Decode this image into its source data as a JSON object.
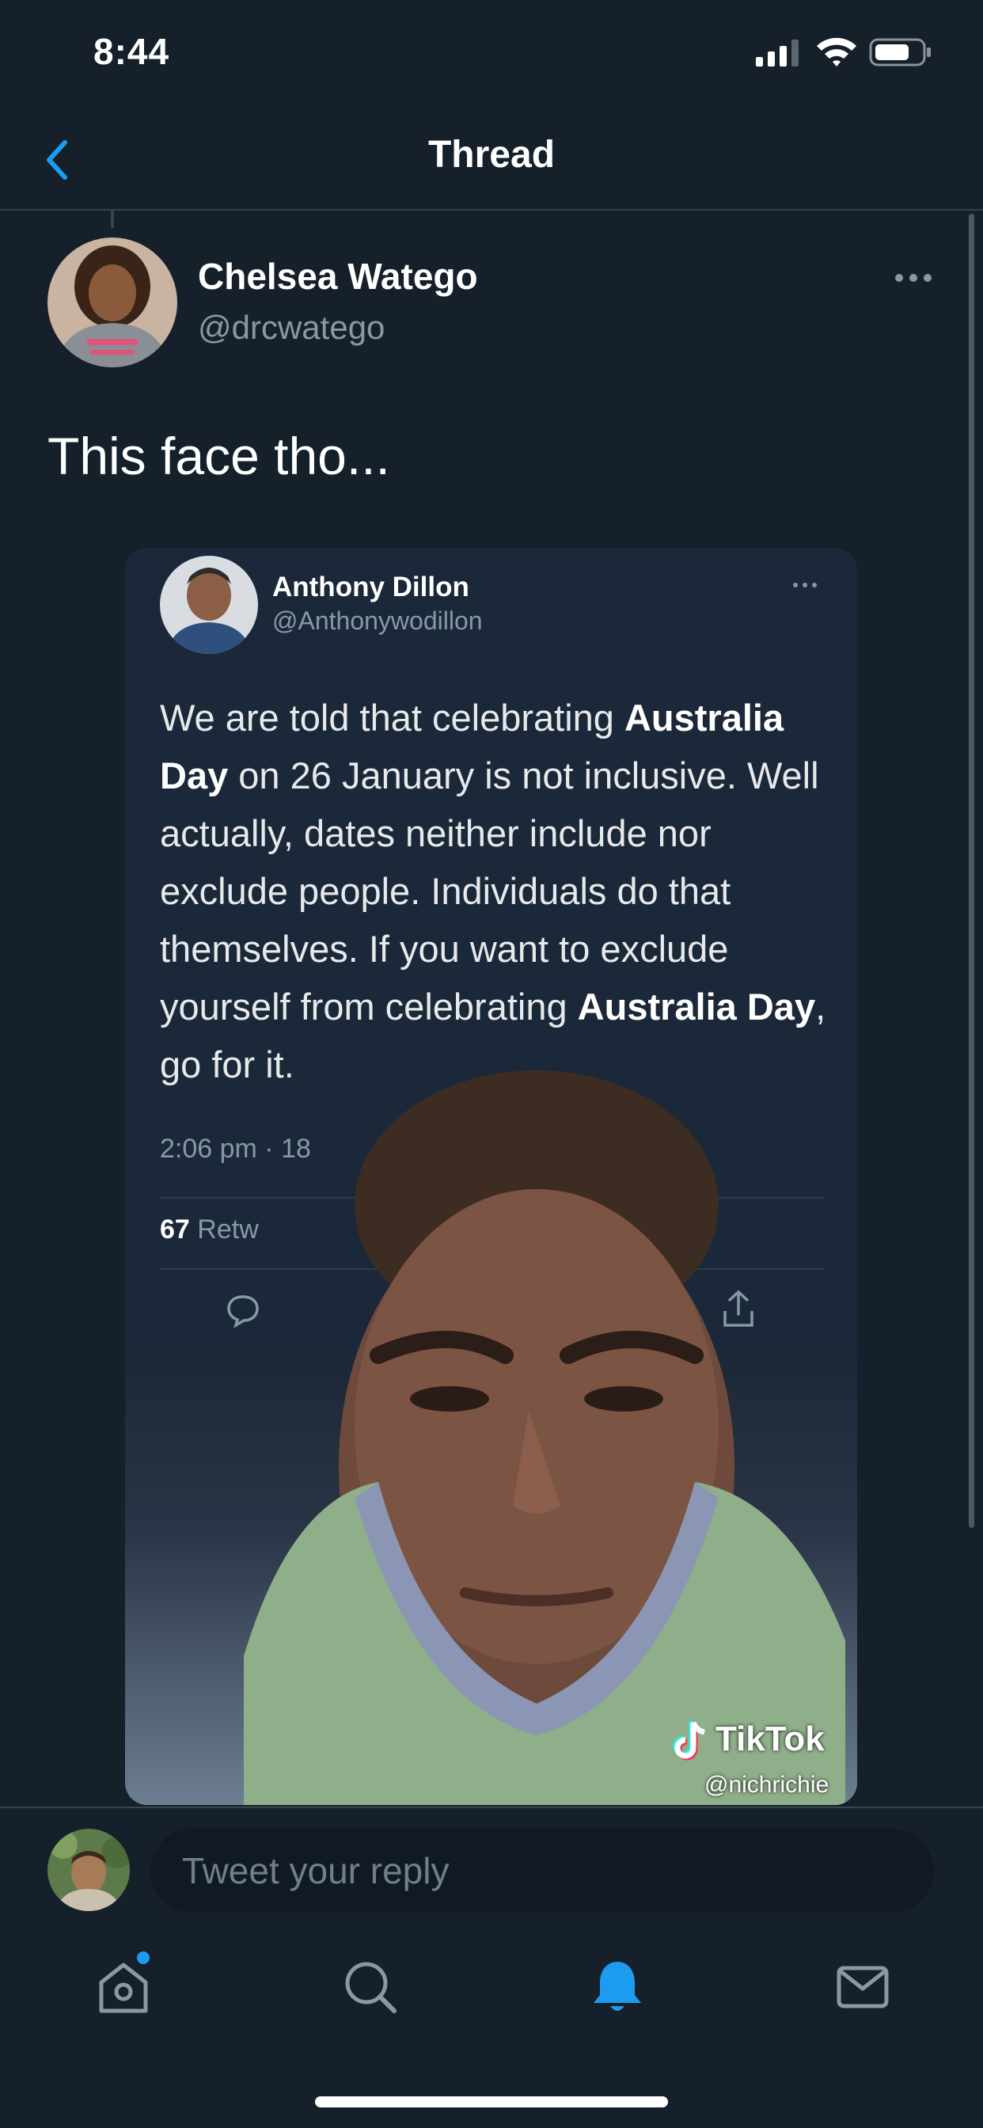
{
  "status_bar": {
    "time": "8:44"
  },
  "header": {
    "title": "Thread"
  },
  "tweet": {
    "author_name": "Chelsea Watego",
    "author_handle": "@drcwatego",
    "text": "This face tho..."
  },
  "embedded_tweet": {
    "author_name": "Anthony Dillon",
    "author_handle": "@Anthonywodillon",
    "text_parts": {
      "p1": "We are told that celebrating ",
      "b1": "Australia Day",
      "p2": " on 26 January is not inclusive. Well actually, dates neither include nor exclude people. Individuals do that themselves. If you want to exclude yourself from celebrating ",
      "b2": "Australia Day",
      "p3": ", go for it."
    },
    "time": "2:06 pm · 18",
    "retweets_count": "67",
    "retweets_label": "Retw"
  },
  "video": {
    "platform": "TikTok",
    "handle": "@nichrichie"
  },
  "reply": {
    "placeholder": "Tweet your reply"
  },
  "tabs": [
    "home-icon",
    "search-icon",
    "notifications-icon",
    "messages-icon"
  ],
  "colors": {
    "accent": "#1d9bf0",
    "background": "#15202b",
    "muted": "#8899a6"
  }
}
